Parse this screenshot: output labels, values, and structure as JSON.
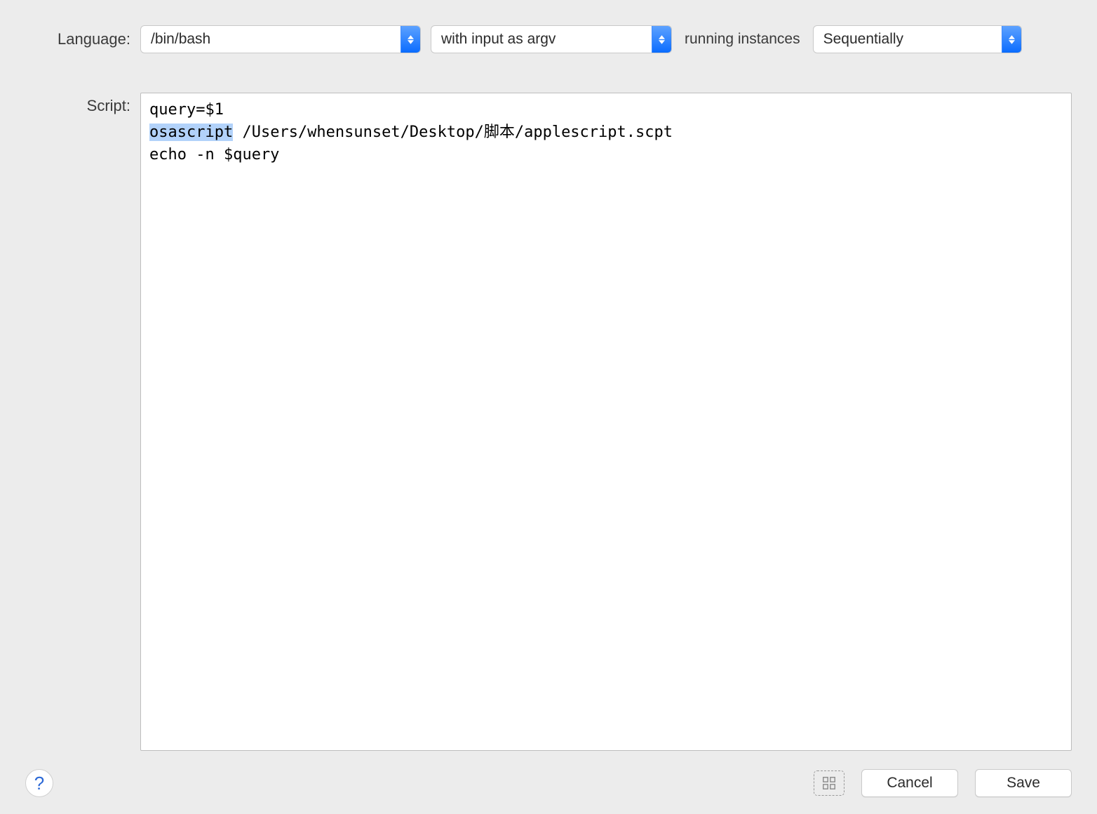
{
  "labels": {
    "language": "Language:",
    "script": "Script:",
    "running_instances": "running instances"
  },
  "selects": {
    "language": "/bin/bash",
    "input_mode": "with input as argv",
    "running_instances": "Sequentially"
  },
  "script": {
    "line1": "query=$1",
    "line2_highlight": "osascript",
    "line2_rest": " /Users/whensunset/Desktop/脚本/applescript.scpt",
    "line3": "echo -n $query"
  },
  "buttons": {
    "help": "?",
    "cancel": "Cancel",
    "save": "Save"
  }
}
